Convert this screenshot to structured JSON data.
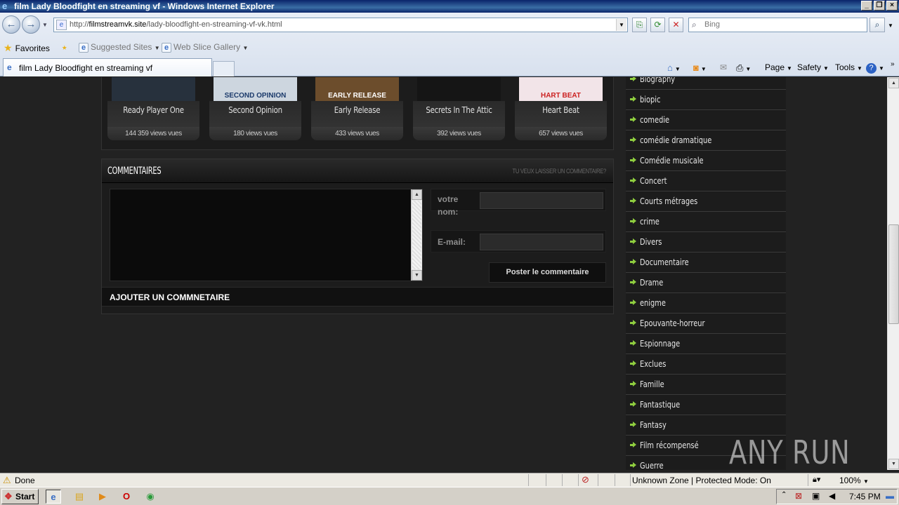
{
  "window": {
    "title": "film Lady Bloodfight en streaming vf - Windows Internet Explorer"
  },
  "address": {
    "url_prefix": "http://",
    "url_host": "filmstreamvk.site",
    "url_path": "/lady-bloodfight-en-streaming-vf-vk.html"
  },
  "search": {
    "placeholder": "Bing"
  },
  "favorites_bar": {
    "favorites_label": "Favorites",
    "suggested_label": "Suggested Sites",
    "webslice_label": "Web Slice Gallery"
  },
  "tab": {
    "title": "film Lady Bloodfight en streaming vf"
  },
  "command_bar": {
    "page_label": "Page",
    "safety_label": "Safety",
    "tools_label": "Tools"
  },
  "movies": [
    {
      "title": "Ready Player One",
      "views": "144 359 views vues",
      "poster_text": "",
      "poster_bg": "#27313d"
    },
    {
      "title": "Second Opinion",
      "views": "180 views vues",
      "poster_text": "SECOND OPINION",
      "poster_bg": "#cdd6df"
    },
    {
      "title": "Early Release",
      "views": "433 views vues",
      "poster_text": "EARLY RELEASE",
      "poster_bg": "#6c4d2c"
    },
    {
      "title": "Secrets In The Attic",
      "views": "392 views vues",
      "poster_text": "",
      "poster_bg": "#151515"
    },
    {
      "title": "Heart Beat",
      "views": "657 views vues",
      "poster_text": "HART BEAT",
      "poster_bg": "#f2e4e8"
    }
  ],
  "comments": {
    "title": "COMMENTAIRES",
    "link": "TU VEUX LAISSER UN COMMENTAIRE?",
    "name_label": "votre nom:",
    "email_label": "E-mail:",
    "post_button": "Poster le commentaire",
    "add_label": "AJOUTER UN COMMNETAIRE"
  },
  "genres": [
    "Biography",
    "biopic",
    "comedie",
    "comédie dramatique",
    "Comédie musicale",
    "Concert",
    "Courts métrages",
    "crime",
    "Divers",
    "Documentaire",
    "Drame",
    "enigme",
    "Epouvante-horreur",
    "Espionnage",
    "Exclues",
    "Famille",
    "Fantastique",
    "Fantasy",
    "Film récompensé",
    "Guerre"
  ],
  "watermark": {
    "text": "ANY RUN"
  },
  "status": {
    "text": "Done",
    "zone": "Unknown Zone | Protected Mode: On",
    "zoom": "100%"
  },
  "taskbar": {
    "start_label": "Start",
    "clock": "7:45 PM"
  },
  "colors": {
    "accent_green": "#8fce3f",
    "page_bg": "#222222"
  }
}
